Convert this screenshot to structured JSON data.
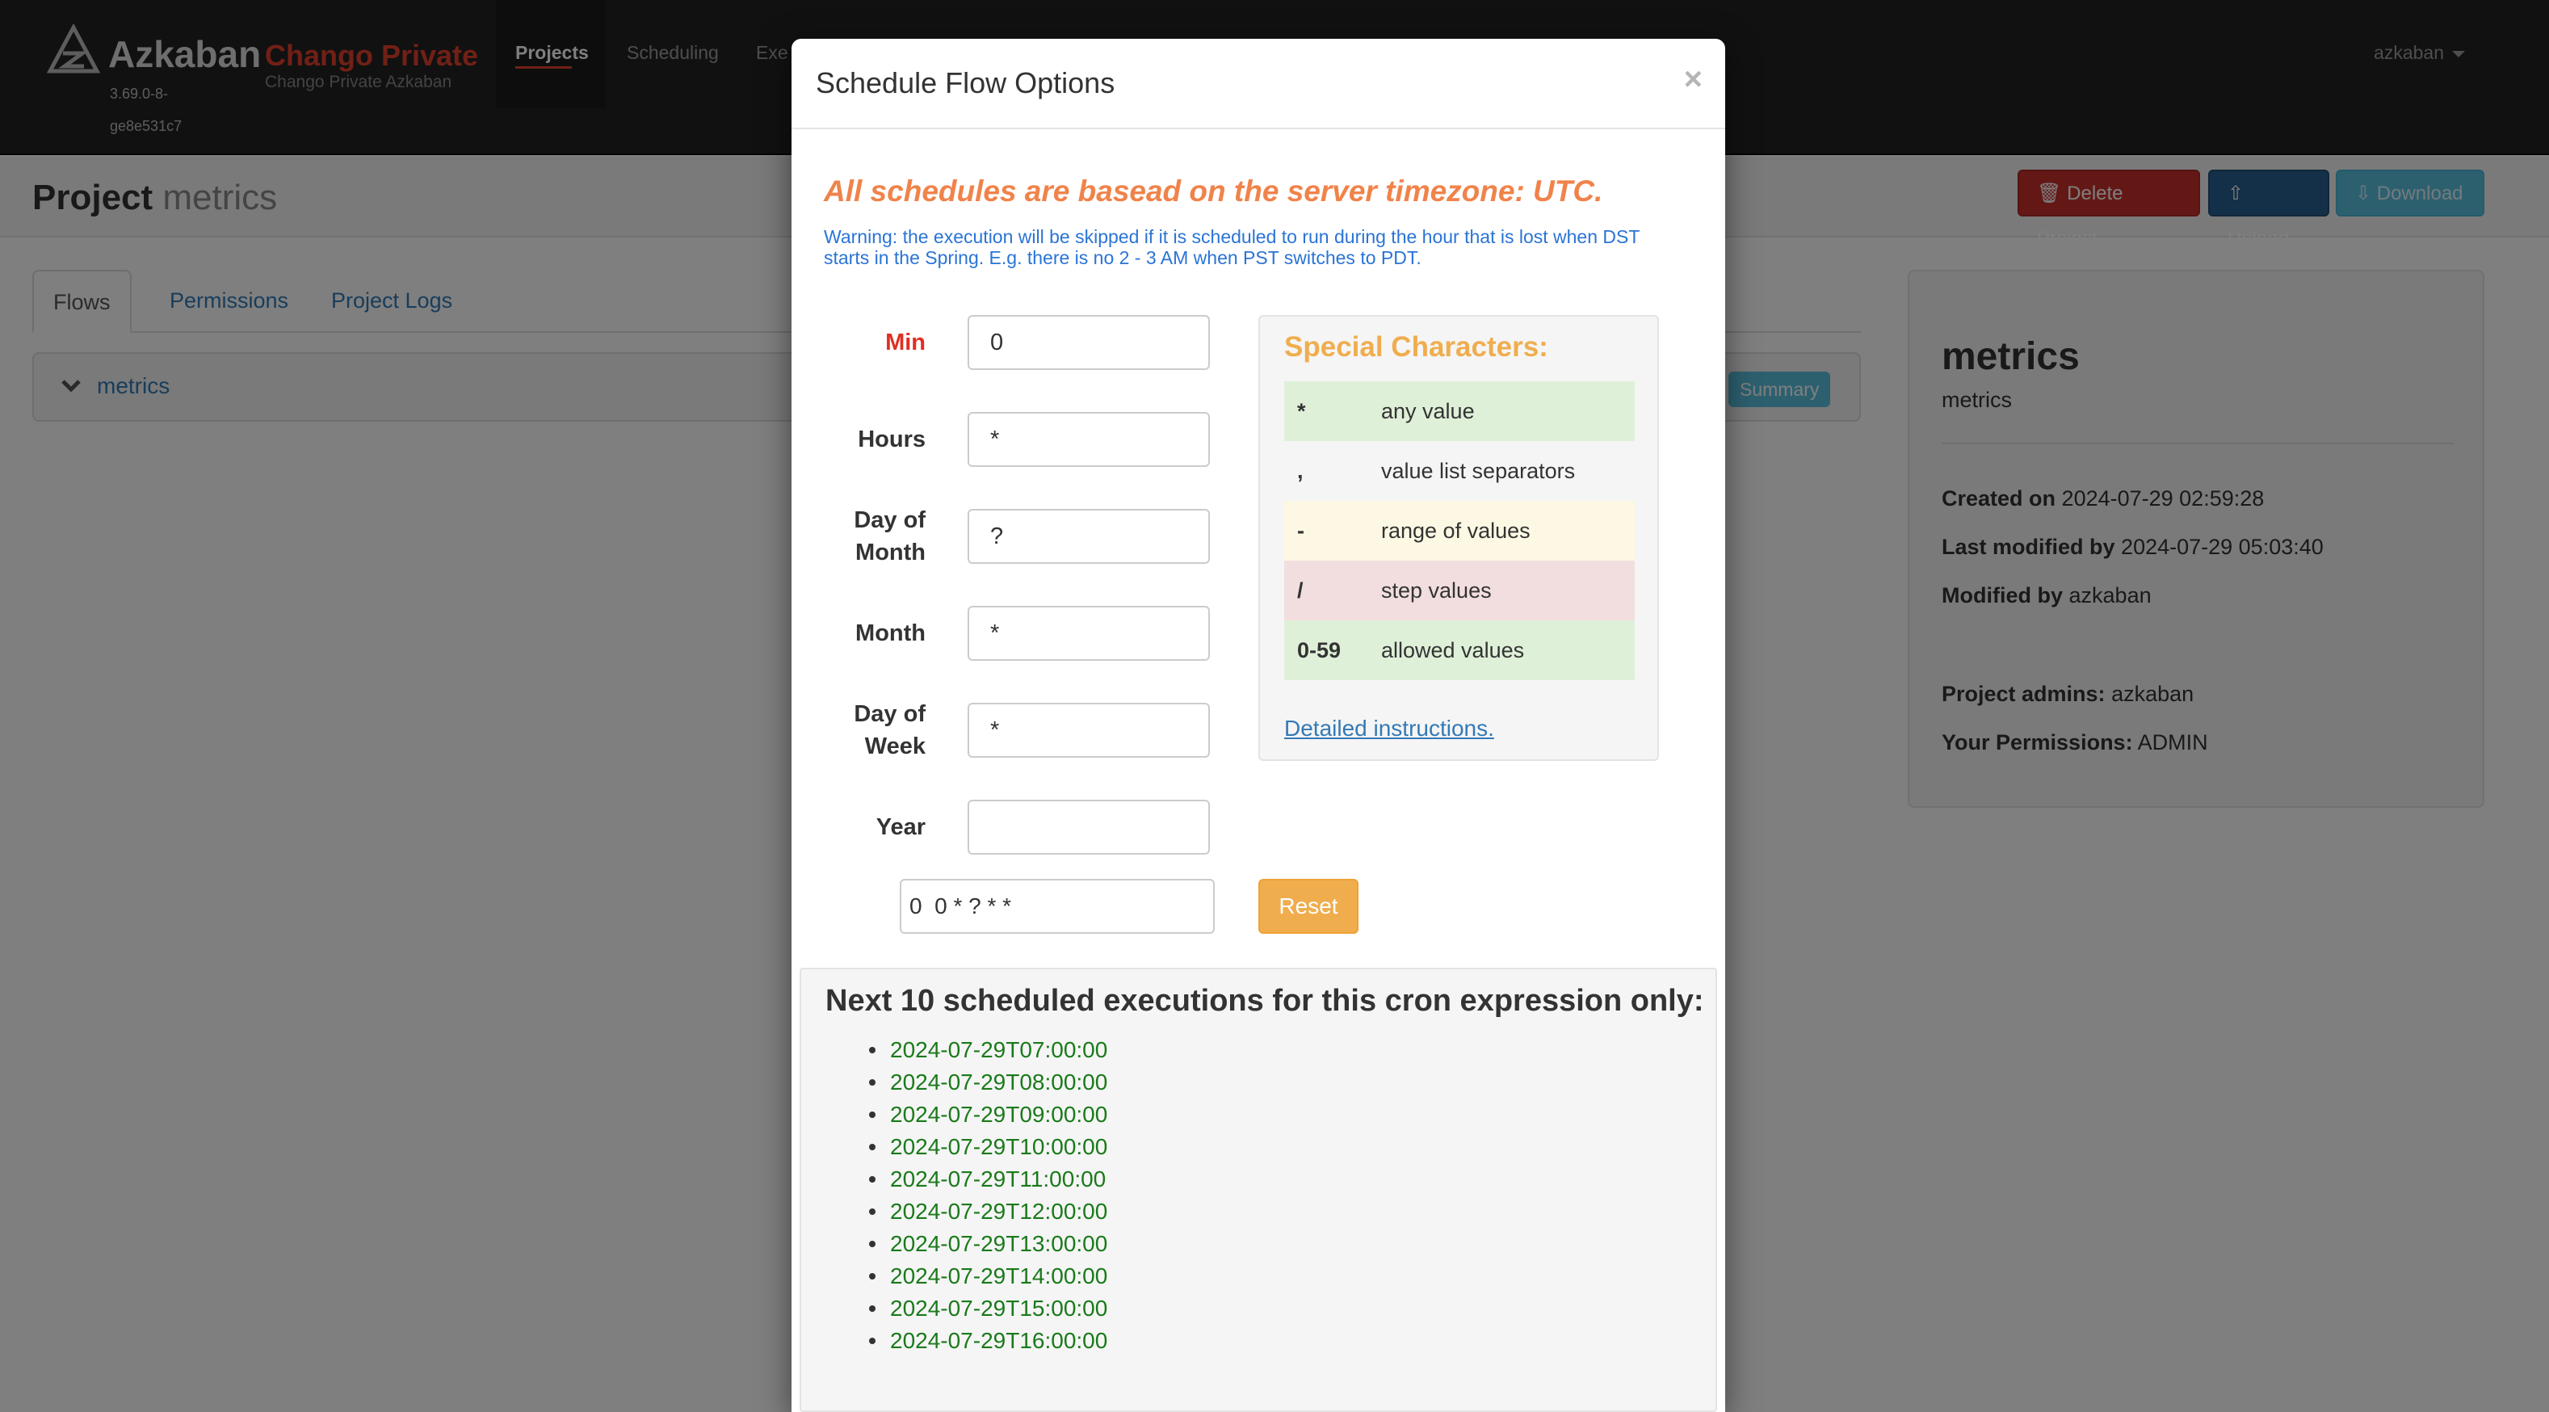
{
  "navbar": {
    "brand": "Azkaban",
    "env_name": "Chango Private",
    "env_subtitle": "Chango Private Azkaban",
    "version": "3.69.0-8-ge8e531c7",
    "nav": {
      "projects": "Projects",
      "scheduling": "Scheduling",
      "executing": "Exe"
    },
    "user": "azkaban"
  },
  "header": {
    "title_prefix": "Project",
    "project_name": "metrics",
    "buttons": {
      "delete": "Delete Project",
      "upload": "Upload",
      "download": "Download"
    }
  },
  "tabs": [
    "Flows",
    "Permissions",
    "Project Logs"
  ],
  "flow": {
    "name": "metrics",
    "summary_label": "Summary"
  },
  "project_info": {
    "name": "metrics",
    "description": "metrics",
    "created_label": "Created on",
    "created": "2024-07-29 02:59:28",
    "modified_label": "Last modified by",
    "modified": "2024-07-29 05:03:40",
    "modified_by_label": "Modified by",
    "modified_by": "azkaban",
    "admins_label": "Project admins:",
    "admins": "azkaban",
    "permissions_label": "Your Permissions:",
    "permissions": "ADMIN"
  },
  "modal": {
    "title": "Schedule Flow Options",
    "close": "×",
    "timezone_note": "All schedules are basead on the server timezone: UTC.",
    "dst_warning": "Warning: the execution will be skipped if it is scheduled to run during the hour that is lost when DST starts in the Spring. E.g. there is no 2 - 3 AM when PST switches to PDT.",
    "fields": {
      "min": {
        "label": "Min",
        "value": "0"
      },
      "hours": {
        "label": "Hours",
        "value": "*"
      },
      "day_of_month": {
        "label": "Day of Month",
        "value": "?"
      },
      "month": {
        "label": "Month",
        "value": "*"
      },
      "day_of_week": {
        "label": "Day of Week",
        "value": "*"
      },
      "year": {
        "label": "Year",
        "value": ""
      }
    },
    "special": {
      "title": "Special Characters:",
      "rows": [
        {
          "symbol": "*",
          "desc": "any value"
        },
        {
          "symbol": ",",
          "desc": "value list separators"
        },
        {
          "symbol": "-",
          "desc": "range of values"
        },
        {
          "symbol": "/",
          "desc": "step values"
        },
        {
          "symbol": "0-59",
          "desc": "allowed values"
        }
      ],
      "link": "Detailed instructions."
    },
    "cron_expression": "0  0 * ? * *",
    "reset": "Reset",
    "next_title": "Next 10 scheduled executions for this cron expression only:",
    "next_executions": [
      "2024-07-29T07:00:00",
      "2024-07-29T08:00:00",
      "2024-07-29T09:00:00",
      "2024-07-29T10:00:00",
      "2024-07-29T11:00:00",
      "2024-07-29T12:00:00",
      "2024-07-29T13:00:00",
      "2024-07-29T14:00:00",
      "2024-07-29T15:00:00",
      "2024-07-29T16:00:00"
    ]
  }
}
